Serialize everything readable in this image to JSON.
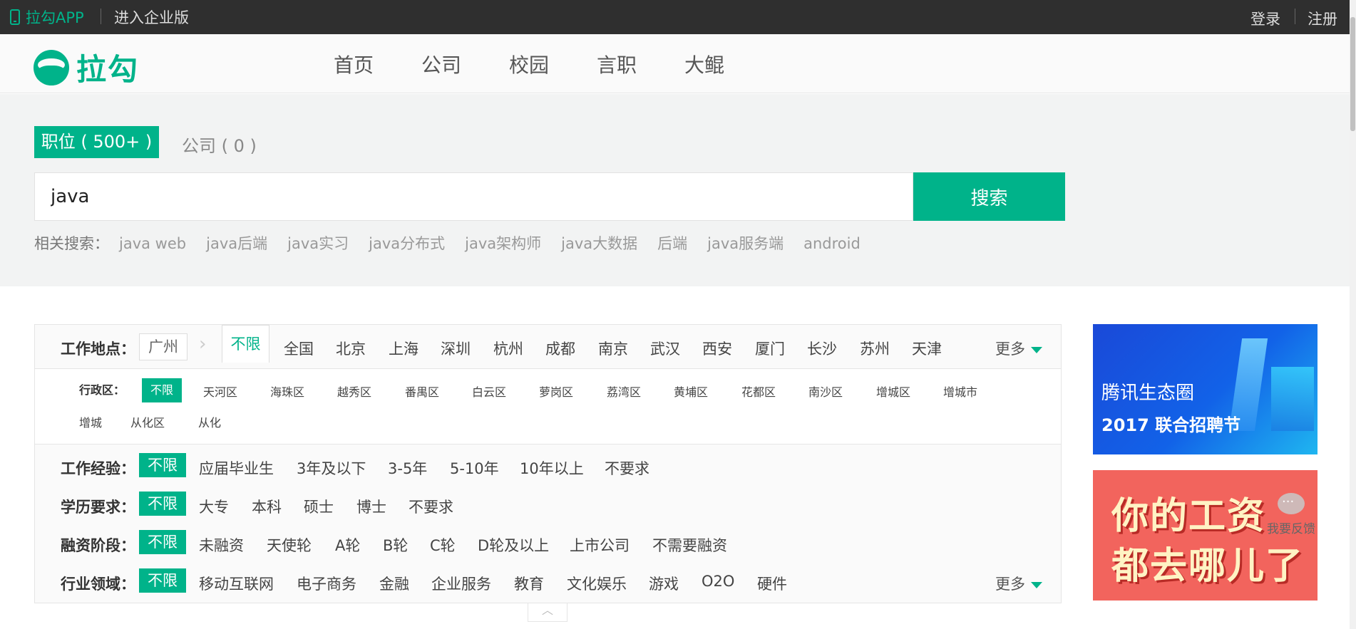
{
  "topbar": {
    "app_label": "拉勾APP",
    "enterprise_label": "进入企业版",
    "login_label": "登录",
    "register_label": "注册"
  },
  "header": {
    "logo_text": "拉勾",
    "nav": [
      "首页",
      "公司",
      "校园",
      "言职",
      "大鲲"
    ]
  },
  "search": {
    "tab_jobs": "职位 ( 500+ )",
    "tab_companies": "公司 ( 0 )",
    "query": "java",
    "button_label": "搜索",
    "related_label": "相关搜索：",
    "related": [
      "java web",
      "java后端",
      "java实习",
      "java分布式",
      "java架构师",
      "java大数据",
      "后端",
      "java服务端",
      "android"
    ]
  },
  "filters": {
    "location": {
      "label": "工作地点：",
      "current_city": "广州",
      "options": [
        "不限",
        "全国",
        "北京",
        "上海",
        "深圳",
        "杭州",
        "成都",
        "南京",
        "武汉",
        "西安",
        "厦门",
        "长沙",
        "苏州",
        "天津"
      ],
      "selected": "不限",
      "more_label": "更多"
    },
    "district": {
      "label": "行政区：",
      "options_row1": [
        "不限",
        "天河区",
        "海珠区",
        "越秀区",
        "番禺区",
        "白云区",
        "萝岗区",
        "荔湾区",
        "黄埔区",
        "花都区",
        "南沙区",
        "增城区",
        "增城市"
      ],
      "options_row2": [
        "增城",
        "从化区",
        "从化"
      ],
      "selected": "不限"
    },
    "experience": {
      "label": "工作经验：",
      "options": [
        "不限",
        "应届毕业生",
        "3年及以下",
        "3-5年",
        "5-10年",
        "10年以上",
        "不要求"
      ],
      "selected": "不限"
    },
    "education": {
      "label": "学历要求：",
      "options": [
        "不限",
        "大专",
        "本科",
        "硕士",
        "博士",
        "不要求"
      ],
      "selected": "不限"
    },
    "funding": {
      "label": "融资阶段：",
      "options": [
        "不限",
        "未融资",
        "天使轮",
        "A轮",
        "B轮",
        "C轮",
        "D轮及以上",
        "上市公司",
        "不需要融资"
      ],
      "selected": "不限"
    },
    "industry": {
      "label": "行业领域：",
      "options": [
        "不限",
        "移动互联网",
        "电子商务",
        "金融",
        "企业服务",
        "教育",
        "文化娱乐",
        "游戏",
        "O2O",
        "硬件"
      ],
      "selected": "不限",
      "more_label": "更多"
    }
  },
  "ads": {
    "ad1_line1": "腾讯生态圈",
    "ad1_line2": "2017 联合招聘节",
    "ad2_line1": "你的工资",
    "ad2_line2": "都去哪儿了"
  },
  "feedback_label": "我要反馈",
  "colors": {
    "brand": "#00b38a",
    "topbar": "#2f2f2f"
  }
}
